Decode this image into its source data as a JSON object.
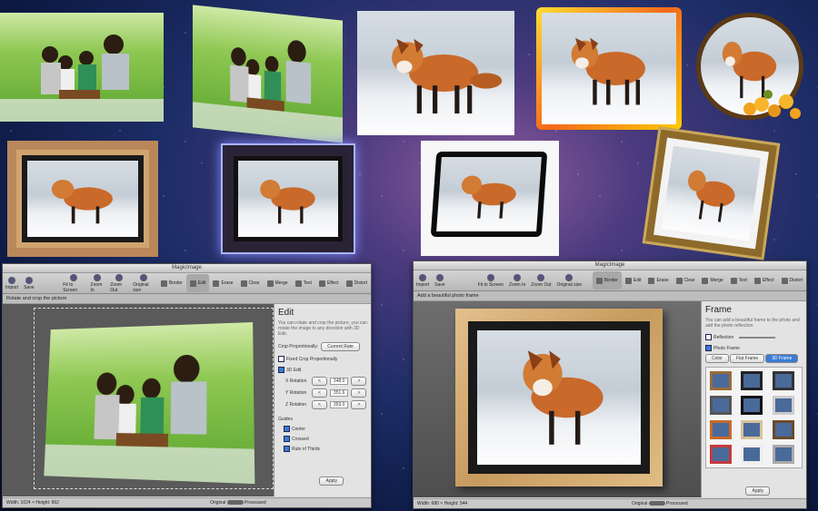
{
  "left_window": {
    "title": "MagicImage",
    "toolbar": {
      "import": "Import",
      "save": "Save",
      "fit": "Fit to Screen",
      "zoom_in": "Zoom In",
      "zoom_out": "Zoom Out",
      "original": "Original size"
    },
    "tabs": [
      "Border",
      "Edit",
      "Erase",
      "Clear",
      "Merge",
      "Text",
      "Effect",
      "Distort"
    ],
    "active_tab": "Edit",
    "hint": "Rotate and crop the picture",
    "panel": {
      "title": "Edit",
      "description": "You can rotate and crop the picture, you can rotate the image to any direction with 3D Edit.",
      "crop_label": "Crop Proportionally:",
      "crop_value": "Current Rate",
      "fixed_crop": "Fixed Crop Proportionally",
      "edit_3d": "3D Edit",
      "x_rotation": "X Rotation",
      "x_value": "348.0",
      "y_rotation": "Y Rotation",
      "y_value": "351.6",
      "z_rotation": "Z Rotation",
      "z_value": "353.0",
      "guides_label": "Guides",
      "guides": [
        "Center",
        "Crossed",
        "Rule of Thirds"
      ],
      "apply": "Apply"
    },
    "status": "Width: 1024 × Height: 662",
    "toggle_left": "Original",
    "toggle_right": "Processed"
  },
  "right_window": {
    "title": "MagicImage",
    "toolbar": {
      "import": "Import",
      "save": "Save",
      "fit": "Fit to Screen",
      "zoom_in": "Zoom In",
      "zoom_out": "Zoom Out",
      "original": "Original size"
    },
    "tabs": [
      "Border",
      "Edit",
      "Erase",
      "Clear",
      "Merge",
      "Text",
      "Effect",
      "Distort"
    ],
    "active_tab": "Border",
    "hint": "Add a beautiful photo frame",
    "panel": {
      "title": "Frame",
      "description": "You can add a beautiful frame to the photo and add the photo reflection.",
      "reflection": "Reflection",
      "photo_frame": "Photo Frame",
      "frame_tabs": [
        "Color",
        "Flat Frame",
        "3D Frame"
      ],
      "active_frame_tab": "3D Frame",
      "apply": "Apply"
    },
    "status": "Width: 680 × Height: 544",
    "toggle_left": "Original",
    "toggle_right": "Processed"
  },
  "colors": {
    "frame_wood": "#c79b5e",
    "glow": "#f36a1b",
    "accent": "#3a7bd5"
  }
}
